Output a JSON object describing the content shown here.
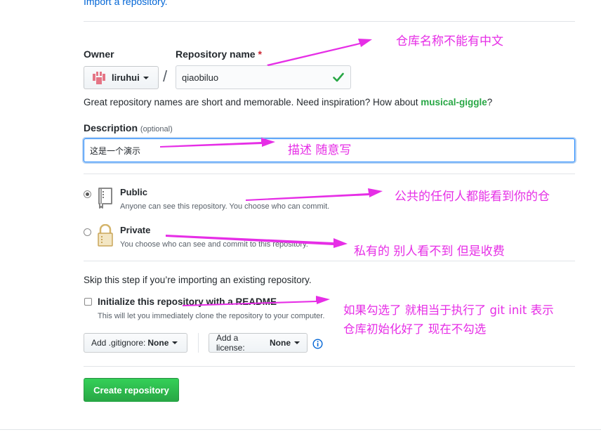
{
  "top_link": "Import a repository.",
  "owner": {
    "label": "Owner",
    "value": "liruhui"
  },
  "repo_name": {
    "label": "Repository name",
    "required_mark": "*",
    "value": "qiaobiluo"
  },
  "separator": "/",
  "hint": {
    "prefix": "Great repository names are short and memorable. Need inspiration? How about ",
    "suggestion": "musical-giggle",
    "suffix": "?"
  },
  "description": {
    "label": "Description",
    "optional": "(optional)",
    "value": "这是一个演示"
  },
  "visibility": {
    "public": {
      "title": "Public",
      "desc": "Anyone can see this repository. You choose who can commit.",
      "checked": true
    },
    "private": {
      "title": "Private",
      "desc": "You choose who can see and commit to this repository.",
      "checked": false
    }
  },
  "skip_text": "Skip this step if you’re importing an existing repository.",
  "readme": {
    "label": "Initialize this repository with a README",
    "desc": "This will let you immediately clone the repository to your computer.",
    "checked": false
  },
  "gitignore": {
    "prefix": "Add .gitignore:",
    "value": "None"
  },
  "license": {
    "prefix": "Add a license:",
    "value": "None"
  },
  "create_button": "Create repository",
  "annotations": {
    "name_note": "仓库名称不能有中文",
    "desc_note": "描述 随意写",
    "public_note": "公共的任何人都能看到你的仓",
    "private_note": "私有的 别人看不到 但是收费",
    "readme_note_1": "如果勾选了 就相当于执行了 git init  表示",
    "readme_note_2": "仓库初始化好了 现在不勾选"
  },
  "colors": {
    "annotation": "#e62ee6",
    "primary": "#28a745",
    "link": "#0366d6",
    "valid": "#28a745"
  },
  "icons": [
    "repo-icon",
    "lock-icon",
    "check-icon",
    "info-icon",
    "caret-down-icon",
    "avatar-icon"
  ]
}
